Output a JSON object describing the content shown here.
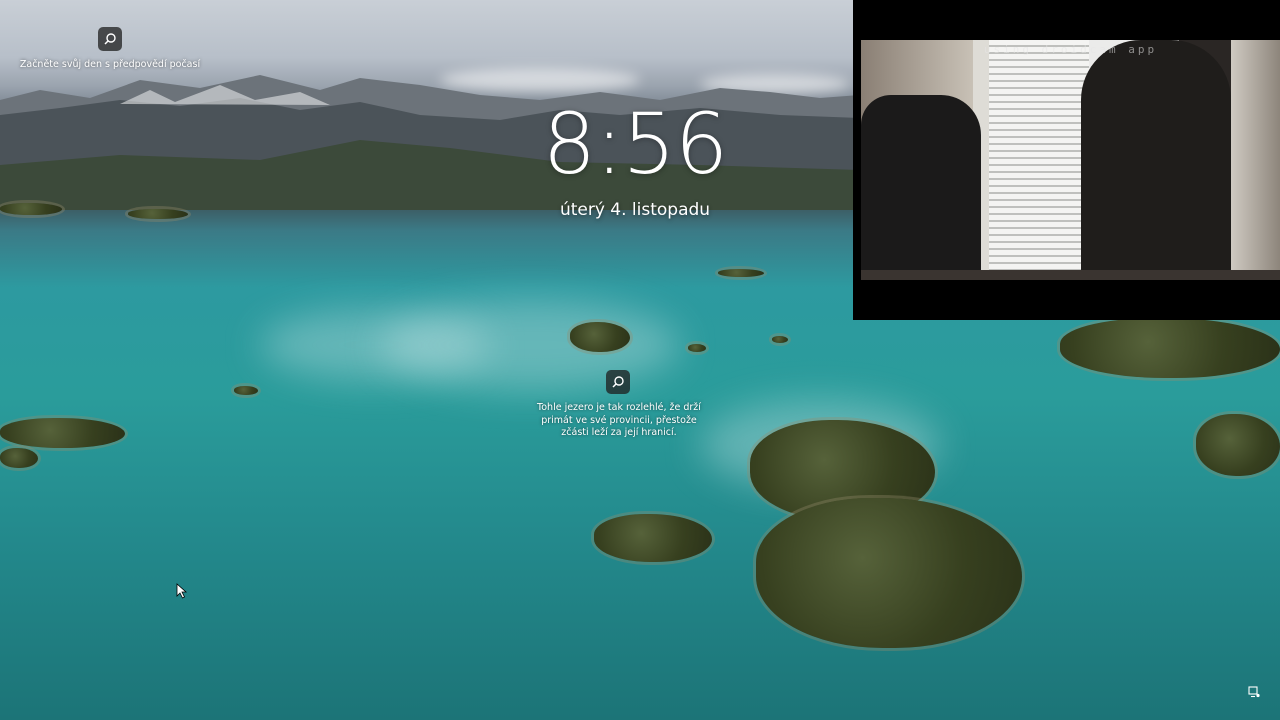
{
  "lockscreen": {
    "weather_prompt": "Začněte svůj den s předpovědí počasí",
    "time": "8:56",
    "date": "úterý 4. listopadu",
    "spotlight_fact": "Tohle jezero je tak rozlehlé, že drží primát ve své provincii, přestože zčásti leží za její hranicí."
  },
  "webcam_overlay": {
    "watermark": "using droidcam app"
  },
  "icons": {
    "weather_search": "search-icon",
    "spotlight_search": "search-icon",
    "cursor": "mouse-pointer-icon",
    "network": "network-status-icon"
  },
  "colors": {
    "lake": "#2a9c9b",
    "sky": "#c9cfd6",
    "text": "#ffffff",
    "overlay_bg": "#000000"
  }
}
